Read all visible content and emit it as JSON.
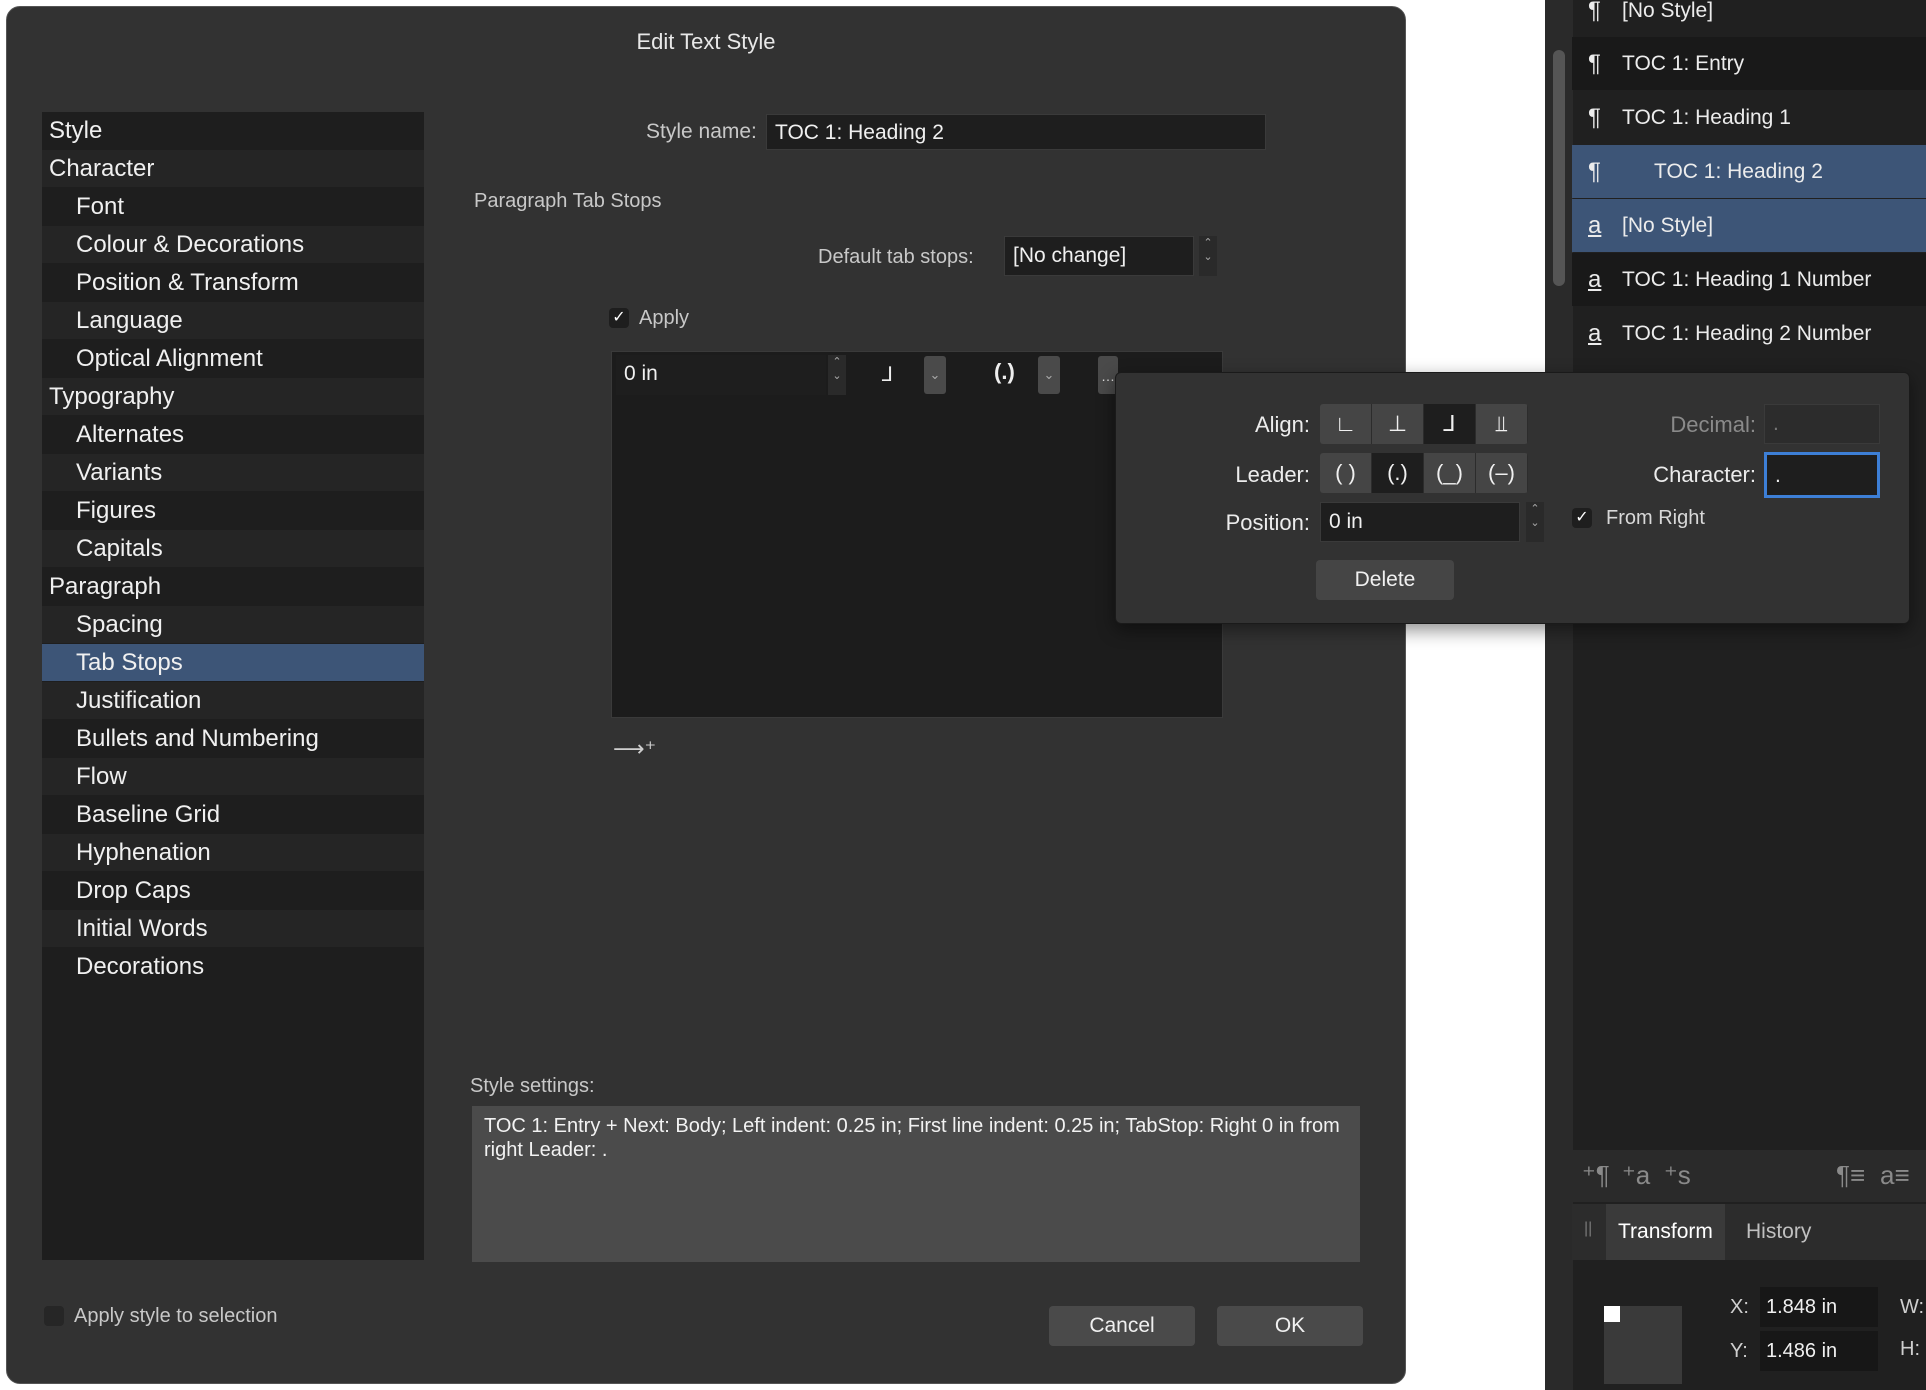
{
  "dialog": {
    "title": "Edit Text Style",
    "style_name_label": "Style name:",
    "style_name_value": "TOC 1: Heading 2",
    "section_title": "Paragraph Tab Stops",
    "default_tab_label": "Default tab stops:",
    "default_tab_value": "[No change]",
    "apply_label": "Apply",
    "tab_position_value": "0 in",
    "style_settings_label": "Style settings:",
    "style_settings_text": "TOC 1: Entry + Next: Body; Left indent: 0.25 in; First line indent: 0.25 in; TabStop: Right 0 in from right Leader: .",
    "apply_to_selection_label": "Apply style to selection",
    "cancel_label": "Cancel",
    "ok_label": "OK"
  },
  "categories": [
    {
      "label": "Style",
      "level": 0
    },
    {
      "label": "Character",
      "level": 0
    },
    {
      "label": "Font",
      "level": 1
    },
    {
      "label": "Colour & Decorations",
      "level": 1
    },
    {
      "label": "Position & Transform",
      "level": 1
    },
    {
      "label": "Language",
      "level": 1
    },
    {
      "label": "Optical Alignment",
      "level": 1
    },
    {
      "label": "Typography",
      "level": 0
    },
    {
      "label": "Alternates",
      "level": 1
    },
    {
      "label": "Variants",
      "level": 1
    },
    {
      "label": "Figures",
      "level": 1
    },
    {
      "label": "Capitals",
      "level": 1
    },
    {
      "label": "Paragraph",
      "level": 0
    },
    {
      "label": "Spacing",
      "level": 1
    },
    {
      "label": "Tab Stops",
      "level": 1,
      "selected": true
    },
    {
      "label": "Justification",
      "level": 1
    },
    {
      "label": "Bullets and Numbering",
      "level": 1
    },
    {
      "label": "Flow",
      "level": 1
    },
    {
      "label": "Baseline Grid",
      "level": 1
    },
    {
      "label": "Hyphenation",
      "level": 1
    },
    {
      "label": "Drop Caps",
      "level": 1
    },
    {
      "label": "Initial Words",
      "level": 1
    },
    {
      "label": "Decorations",
      "level": 1
    }
  ],
  "popover": {
    "align_label": "Align:",
    "leader_label": "Leader:",
    "position_label": "Position:",
    "position_value": "0 in",
    "decimal_label": "Decimal:",
    "decimal_value": ".",
    "character_label": "Character:",
    "character_value": ".",
    "from_right_label": "From Right",
    "delete_label": "Delete",
    "leader_options": [
      "( )",
      "(.)",
      "(_)",
      "(–)"
    ]
  },
  "styles_panel": {
    "items": [
      {
        "label": "[No Style]",
        "type": "paragraph"
      },
      {
        "label": "TOC 1: Entry",
        "type": "paragraph"
      },
      {
        "label": "TOC 1: Heading 1",
        "type": "paragraph"
      },
      {
        "label": "TOC 1: Heading 2",
        "type": "paragraph",
        "selected": true
      },
      {
        "label": "[No Style]",
        "type": "character",
        "selected": true
      },
      {
        "label": "TOC 1: Heading 1 Number",
        "type": "character"
      },
      {
        "label": "TOC 1: Heading 2 Number",
        "type": "character"
      }
    ],
    "glyph_paragraph": "¶",
    "glyph_character": "a"
  },
  "transform_panel": {
    "tabs": [
      "Transform",
      "History"
    ],
    "x_label": "X:",
    "x_value": "1.848 in",
    "y_label": "Y:",
    "y_value": "1.486 in",
    "w_label": "W:",
    "h_label": "H:"
  },
  "colors": {
    "accent": "#3d5577",
    "dialog_bg": "#323232",
    "list_bg": "#1e1e1e",
    "focus": "#3d7fd6"
  }
}
